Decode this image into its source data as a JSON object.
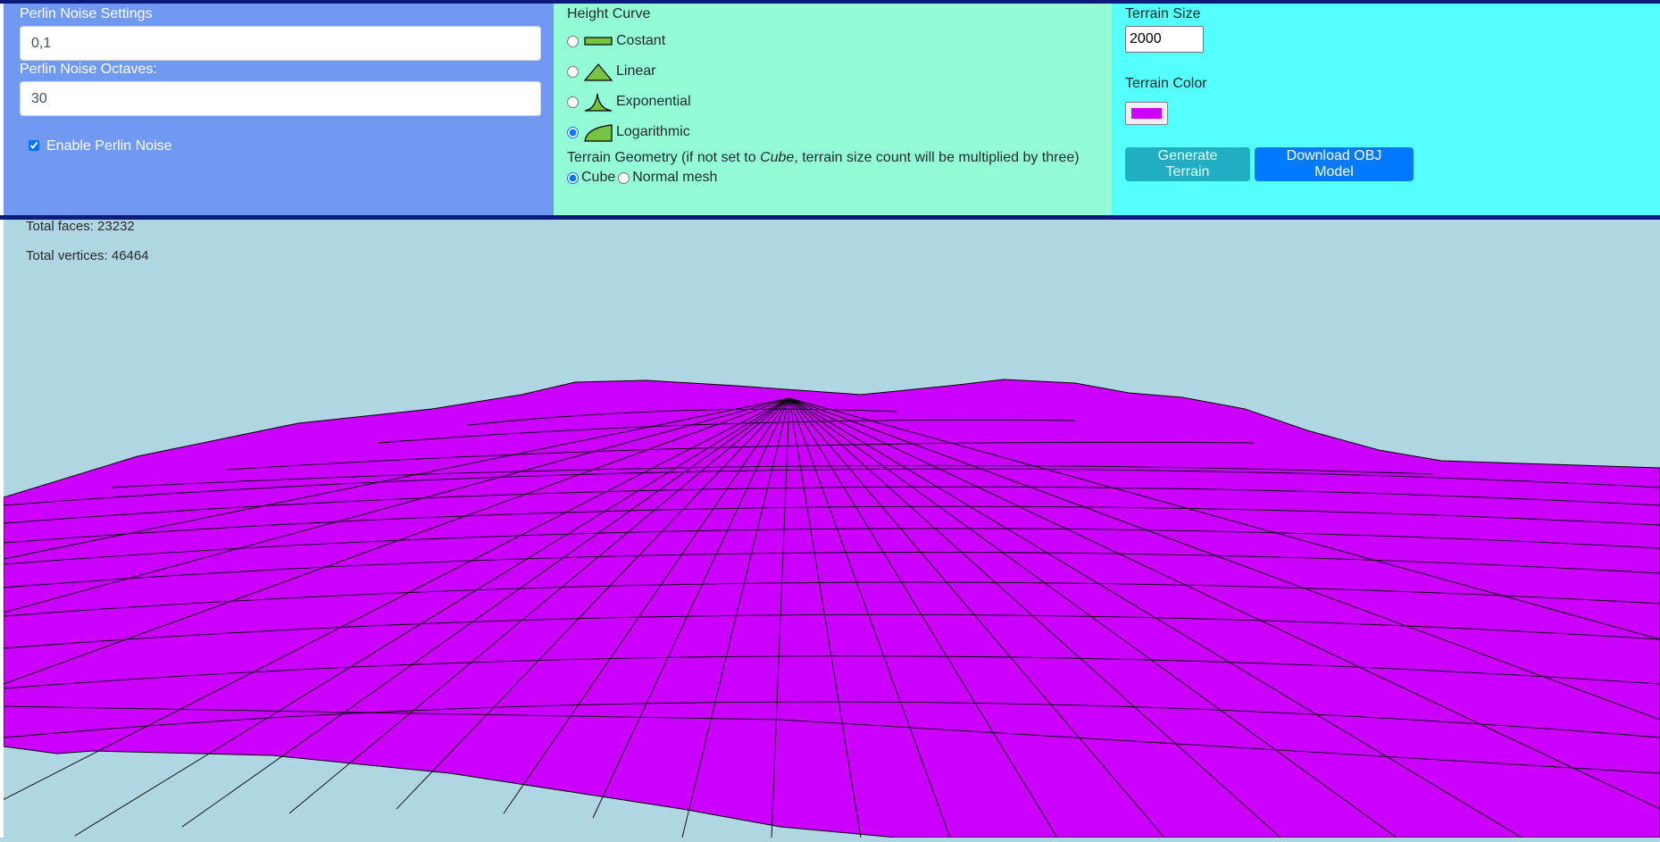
{
  "perlin": {
    "settings_label": "Perlin Noise Settings",
    "settings_value": "0,1",
    "octaves_label": "Perlin Noise Octaves:",
    "octaves_value": "30",
    "enable_label": "Enable Perlin Noise",
    "enable_checked": true
  },
  "height_curve": {
    "label": "Height Curve",
    "options": [
      {
        "label": "Costant",
        "icon": "flat-curve-icon",
        "selected": false
      },
      {
        "label": "Linear",
        "icon": "triangle-curve-icon",
        "selected": false
      },
      {
        "label": "Exponential",
        "icon": "exponential-curve-icon",
        "selected": false
      },
      {
        "label": "Logarithmic",
        "icon": "logarithmic-curve-icon",
        "selected": true
      }
    ],
    "curve_icon_fill": "#76c442"
  },
  "geometry": {
    "label_prefix": "Terrain Geometry (if not set to ",
    "label_emphasis": "Cube",
    "label_suffix": ", terrain size count will be multiplied by three)",
    "options": [
      {
        "label": "Cube",
        "selected": true
      },
      {
        "label": "Normal mesh",
        "selected": false
      }
    ]
  },
  "terrain": {
    "size_label": "Terrain Size",
    "size_value": "2000",
    "color_label": "Terrain Color",
    "color_value": "#cc00ff",
    "generate_label": "Generate Terrain",
    "download_label": "Download OBJ Model"
  },
  "stats": {
    "faces": "Total faces: 23232",
    "vertices": "Total vertices: 46464"
  },
  "colors": {
    "header_bar": "#0c1a7c",
    "perlin_panel": "#7099f1",
    "curve_panel": "#93fcd6",
    "terrain_panel": "#54fffc",
    "sky": "#b0d6e4",
    "terrain": "#cc00ff",
    "generate_button": "#17a2b8",
    "download_button": "#007bff"
  }
}
